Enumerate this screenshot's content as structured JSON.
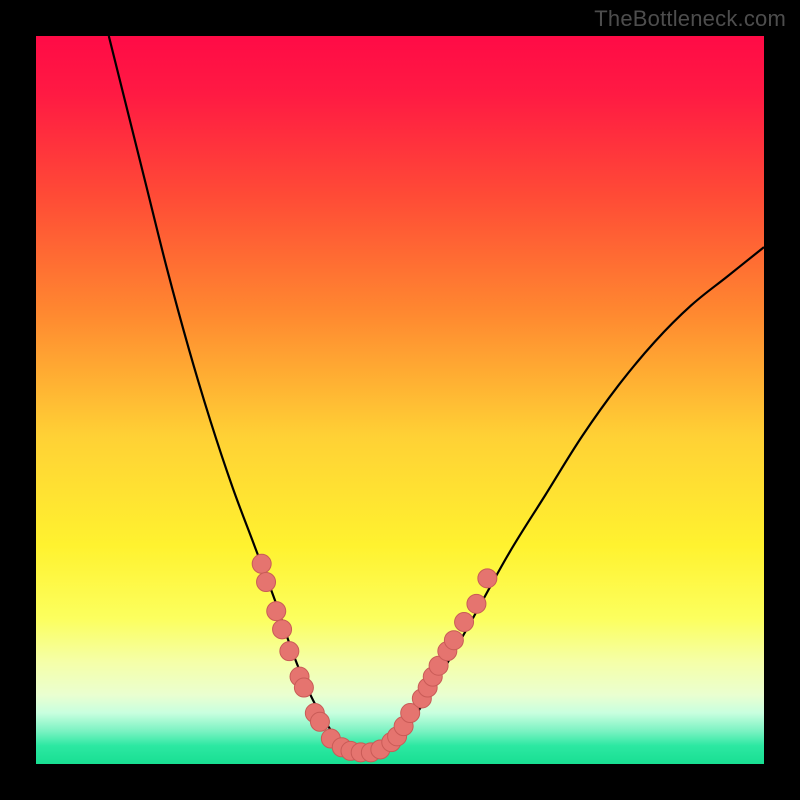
{
  "watermark": "TheBottleneck.com",
  "colors": {
    "frame": "#000000",
    "curve": "#000000",
    "dot_fill": "#e5746f",
    "dot_stroke": "#c95b57",
    "gradient_stops": [
      {
        "offset": 0.0,
        "color": "#ff0b46"
      },
      {
        "offset": 0.08,
        "color": "#ff1a43"
      },
      {
        "offset": 0.22,
        "color": "#ff4b36"
      },
      {
        "offset": 0.38,
        "color": "#ff8830"
      },
      {
        "offset": 0.55,
        "color": "#ffd135"
      },
      {
        "offset": 0.7,
        "color": "#fff22f"
      },
      {
        "offset": 0.8,
        "color": "#fcff5e"
      },
      {
        "offset": 0.86,
        "color": "#f5ffa8"
      },
      {
        "offset": 0.905,
        "color": "#eaffd0"
      },
      {
        "offset": 0.93,
        "color": "#c8ffdf"
      },
      {
        "offset": 0.955,
        "color": "#7af2c2"
      },
      {
        "offset": 0.975,
        "color": "#2ce8a2"
      },
      {
        "offset": 1.0,
        "color": "#18df92"
      }
    ]
  },
  "chart_data": {
    "type": "line",
    "title": "",
    "xlabel": "",
    "ylabel": "",
    "xlim": [
      0,
      100
    ],
    "ylim": [
      0,
      100
    ],
    "grid": false,
    "series": [
      {
        "name": "bottleneck-curve",
        "x": [
          10,
          12,
          15,
          18,
          21,
          24,
          27,
          30,
          33,
          35,
          37,
          39,
          41,
          43,
          47,
          50,
          53,
          56,
          60,
          65,
          70,
          75,
          80,
          85,
          90,
          95,
          100
        ],
        "y": [
          100,
          92,
          80,
          68,
          57,
          47,
          38,
          30,
          22,
          16,
          11,
          7,
          4,
          2,
          2,
          4,
          8,
          13,
          20,
          29,
          37,
          45,
          52,
          58,
          63,
          67,
          71
        ]
      }
    ],
    "dots": {
      "name": "highlighted-points",
      "points": [
        {
          "x": 31.0,
          "y": 27.5
        },
        {
          "x": 31.6,
          "y": 25.0
        },
        {
          "x": 33.0,
          "y": 21.0
        },
        {
          "x": 33.8,
          "y": 18.5
        },
        {
          "x": 34.8,
          "y": 15.5
        },
        {
          "x": 36.2,
          "y": 12.0
        },
        {
          "x": 36.8,
          "y": 10.5
        },
        {
          "x": 38.3,
          "y": 7.0
        },
        {
          "x": 39.0,
          "y": 5.8
        },
        {
          "x": 40.5,
          "y": 3.5
        },
        {
          "x": 42.0,
          "y": 2.3
        },
        {
          "x": 43.2,
          "y": 1.8
        },
        {
          "x": 44.6,
          "y": 1.6
        },
        {
          "x": 46.0,
          "y": 1.6
        },
        {
          "x": 47.3,
          "y": 2.0
        },
        {
          "x": 48.8,
          "y": 3.0
        },
        {
          "x": 49.6,
          "y": 3.8
        },
        {
          "x": 50.5,
          "y": 5.2
        },
        {
          "x": 51.4,
          "y": 7.0
        },
        {
          "x": 53.0,
          "y": 9.0
        },
        {
          "x": 53.8,
          "y": 10.5
        },
        {
          "x": 54.5,
          "y": 12.0
        },
        {
          "x": 55.3,
          "y": 13.5
        },
        {
          "x": 56.5,
          "y": 15.5
        },
        {
          "x": 57.4,
          "y": 17.0
        },
        {
          "x": 58.8,
          "y": 19.5
        },
        {
          "x": 60.5,
          "y": 22.0
        },
        {
          "x": 62.0,
          "y": 25.5
        }
      ]
    }
  }
}
